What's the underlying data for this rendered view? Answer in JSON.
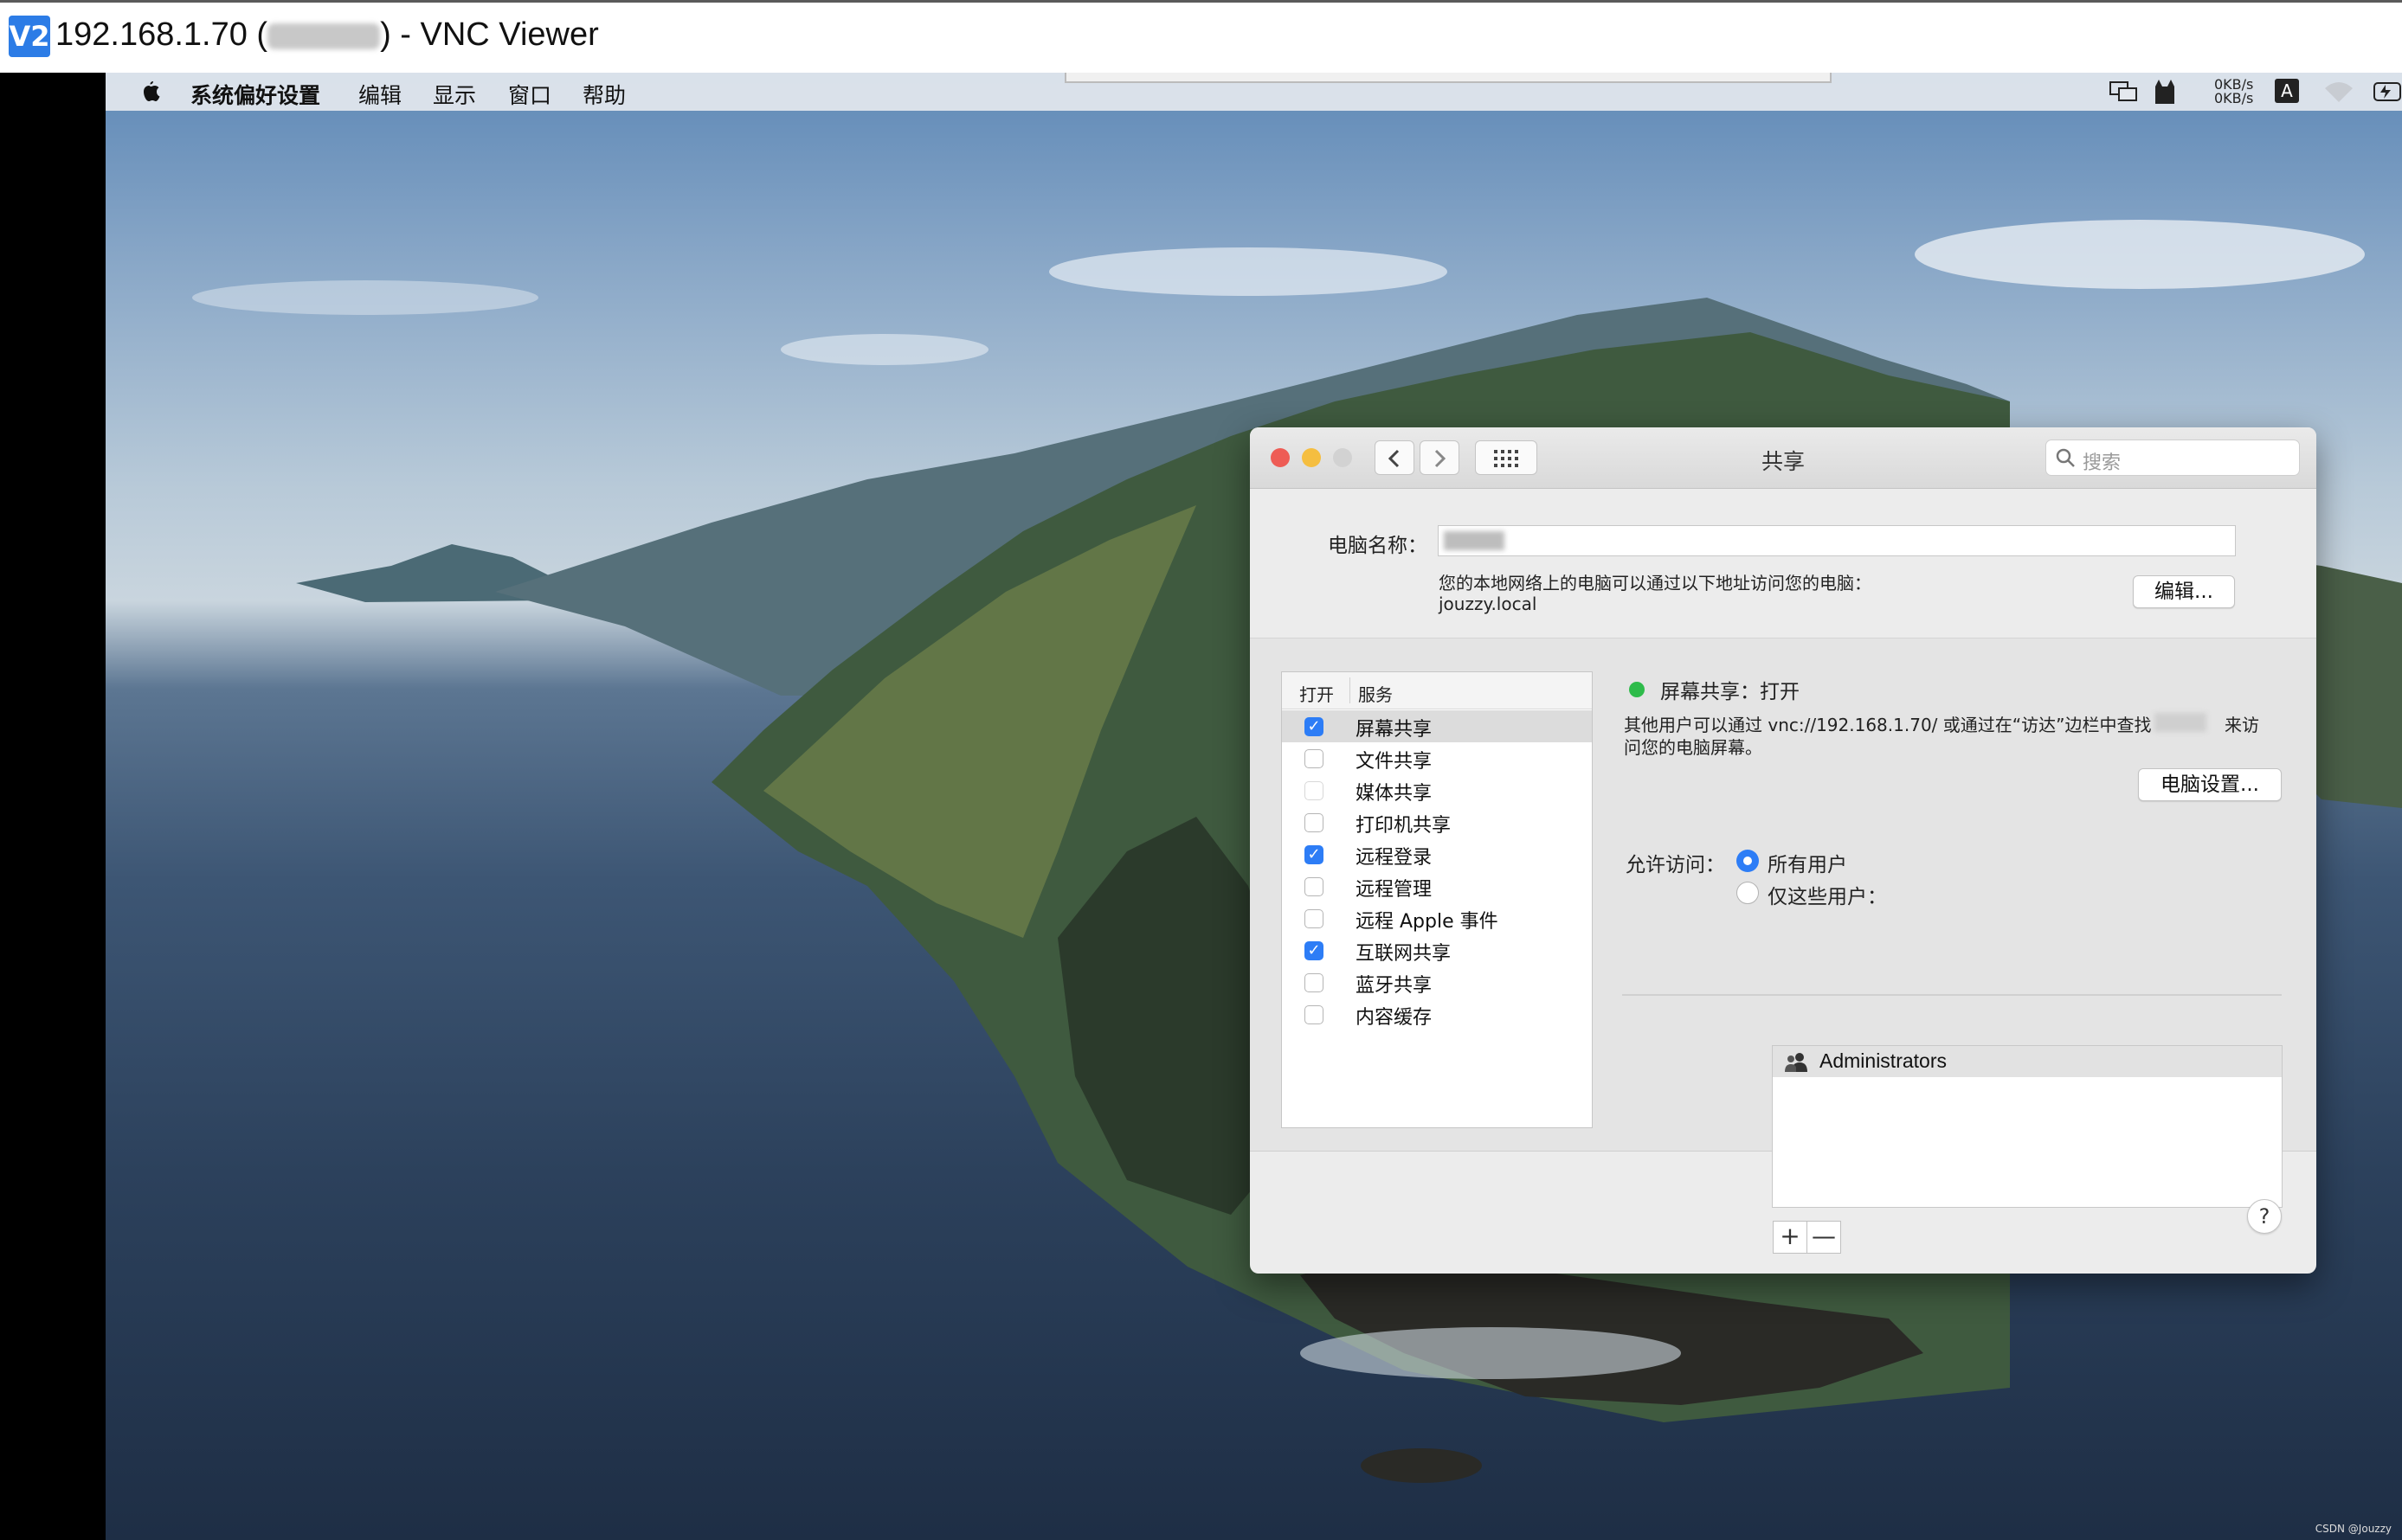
{
  "vnc": {
    "title_prefix": "192.168.1.70 (",
    "title_suffix": ") - VNC Viewer",
    "logo_text": "V2"
  },
  "menubar": {
    "items": [
      "系统偏好设置",
      "编辑",
      "显示",
      "窗口",
      "帮助"
    ],
    "net_up": "0KB/s",
    "net_down": "0KB/s",
    "input_method": "A"
  },
  "window": {
    "title": "共享",
    "search_placeholder": "搜索",
    "computer_name_label": "电脑名称：",
    "address_hint": "您的本地网络上的电脑可以通过以下地址访问您的电脑：",
    "address_value": "jouzzy.local",
    "edit_button": "编辑...",
    "table_header_on": "打开",
    "table_header_service": "服务",
    "services": [
      {
        "label": "屏幕共享",
        "checked": true
      },
      {
        "label": "文件共享",
        "checked": false
      },
      {
        "label": "媒体共享",
        "checked": false
      },
      {
        "label": "打印机共享",
        "checked": false
      },
      {
        "label": "远程登录",
        "checked": true
      },
      {
        "label": "远程管理",
        "checked": false
      },
      {
        "label": "远程 Apple 事件",
        "checked": false
      },
      {
        "label": "互联网共享",
        "checked": true
      },
      {
        "label": "蓝牙共享",
        "checked": false
      },
      {
        "label": "内容缓存",
        "checked": false
      }
    ],
    "status_text": "屏幕共享：打开",
    "desc_line1": "其他用户可以通过 vnc://192.168.1.70/ 或通过在“访达”边栏中查找",
    "desc_line1_end": "来访",
    "desc_line2": "问您的电脑屏幕。",
    "computer_settings_button": "电脑设置...",
    "allow_label": "允许访问：",
    "radio_all": "所有用户",
    "radio_only": "仅这些用户：",
    "users": [
      "Administrators"
    ],
    "add_button": "+",
    "remove_button": "—",
    "help_button": "?"
  },
  "watermark": "CSDN @Jouzzy",
  "colors": {
    "accent": "#2d7df6",
    "status_on": "#2ebb4a"
  }
}
